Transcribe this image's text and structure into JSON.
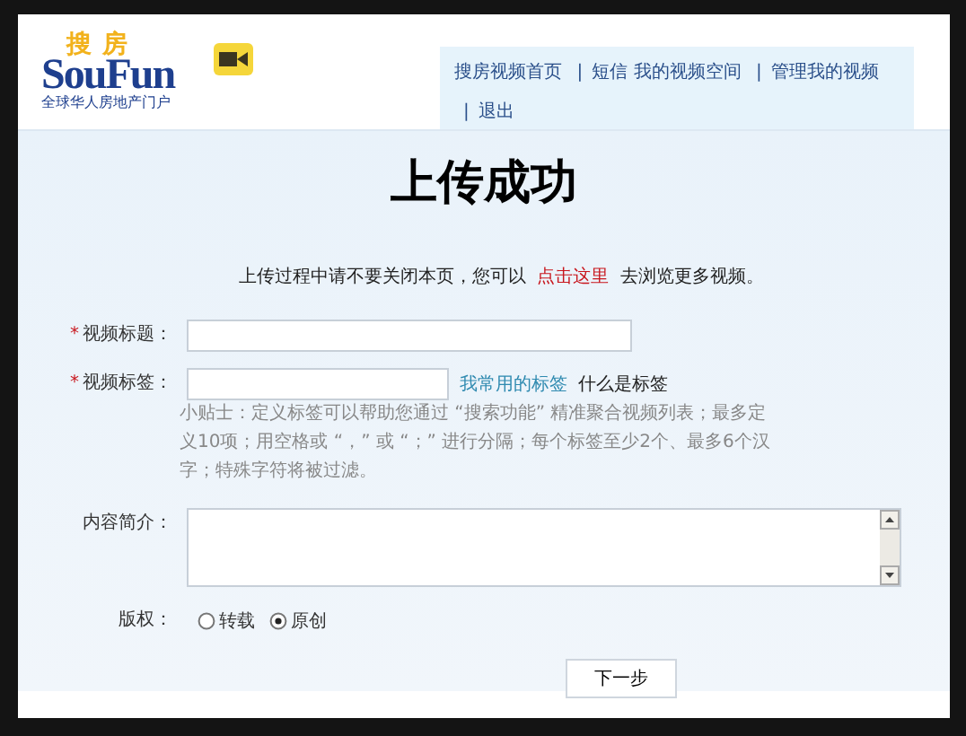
{
  "logo": {
    "chinese": "搜房",
    "latin": "SouFun",
    "tagline": "全球华人房地产门户"
  },
  "nav": [
    {
      "kind": "link",
      "text": "搜房视频首页"
    },
    {
      "kind": "separator",
      "text": "|"
    },
    {
      "kind": "link",
      "text": "短信"
    },
    {
      "kind": "link",
      "text": "我的视频空间"
    },
    {
      "kind": "separator",
      "text": "|"
    },
    {
      "kind": "link",
      "text": "管理我的视频"
    },
    {
      "kind": "separator",
      "text": "|"
    },
    {
      "kind": "link",
      "text": "退出"
    }
  ],
  "heading": "上传成功",
  "notice": {
    "before": "上传过程中请不要关闭本页，您可以",
    "link": "点击这里",
    "after": "去浏览更多视频。"
  },
  "form": {
    "fields": [
      {
        "kind": "text",
        "label": "视频标题：",
        "required_mark": "*"
      },
      {
        "kind": "tags",
        "label": "视频标签：",
        "required_mark": "*",
        "link": "我常用的标签",
        "help": "什么是标签",
        "hint": "小贴士：定义标签可以帮助您通过 “搜索功能” 精准聚合视频列表；最多定义10项；用空格或 “，” 或 “；” 进行分隔；每个标签至少2个、最多6个汉字；特殊字符将被过滤。"
      },
      {
        "kind": "textarea",
        "label": "内容简介："
      },
      {
        "kind": "radio",
        "label": "版权：",
        "options": [
          {
            "label": "转载",
            "selected": false
          },
          {
            "label": "原创",
            "selected": true
          }
        ]
      }
    ],
    "submit": "下一步"
  }
}
